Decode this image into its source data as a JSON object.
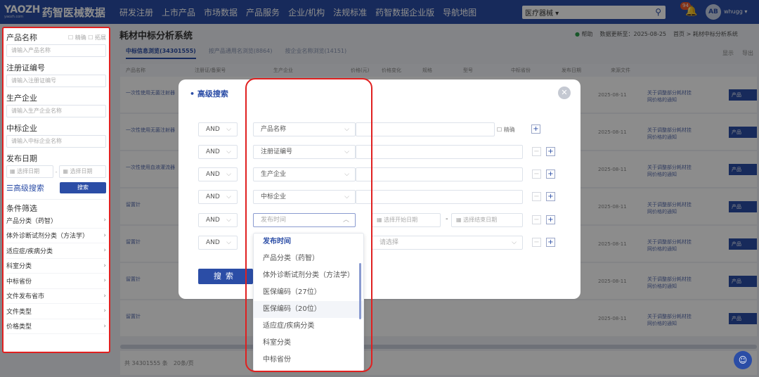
{
  "topbar": {
    "logo_mark": "YAOZH",
    "logo_sub": "yaozh.com",
    "logo_name": "药智医械数据",
    "nav": [
      "研发注册",
      "上市产品",
      "市场数据",
      "产品服务",
      "企业/机构",
      "法规标准",
      "药智数据企业版",
      "导航地图"
    ],
    "search_scope": "医疗器械",
    "badge_count": "94",
    "avatar_text": "AB",
    "username": "whugg"
  },
  "sidebar": {
    "product_name_label": "产品名称",
    "exact_label": "精确",
    "broad_label": "拓展",
    "product_name_placeholder": "请输入产品名称",
    "reg_no_label": "注册证编号",
    "reg_no_placeholder": "请输入注册证编号",
    "manufacturer_label": "生产企业",
    "manufacturer_placeholder": "请输入生产企业名称",
    "bid_company_label": "中标企业",
    "bid_company_placeholder": "请输入中标企业名称",
    "publish_date_label": "发布日期",
    "date_start": "选择日期",
    "date_end": "选择日期",
    "advanced_link": "高级搜索",
    "search_button": "搜索",
    "filter_title": "条件筛选",
    "filters": [
      "产品分类（药智）",
      "体外诊断试剂分类（方法学）",
      "适应症/疾病分类",
      "科室分类",
      "中标省份",
      "文件发布省市",
      "文件类型",
      "价格类型"
    ]
  },
  "main": {
    "title": "耗材中标分析系统",
    "help": "帮助",
    "updated": "数据更新至：2025-08-25",
    "breadcrumb": "首页 > 耗材中标分析系统",
    "tabs": [
      "中标信息浏览(34301555)",
      "按产品通用名浏览(8864)",
      "按企业名称浏览(14151)"
    ],
    "right_actions": [
      "显示",
      "导出"
    ],
    "columns": [
      "产品名称",
      "注册证/备案号",
      "生产企业",
      "价格(元)",
      "价格变化",
      "规格",
      "型号",
      "中标省份",
      "发布日期",
      "来源文件"
    ],
    "rows": [
      {
        "name": "一次性使用无菌注射器",
        "date": "2025-08-11",
        "file": "关于调整部分耗材挂网价格的通知",
        "btn": "产品"
      },
      {
        "name": "一次性使用无菌注射器",
        "date": "2025-08-11",
        "file": "关于调整部分耗材挂网价格的通知",
        "btn": "产品"
      },
      {
        "name": "一次性使用血液灌流器",
        "date": "2025-08-11",
        "file": "关于调整部分耗材挂网价格的通知",
        "btn": "产品"
      },
      {
        "name": "留置针",
        "date": "2025-08-11",
        "file": "关于调整部分耗材挂网价格的通知",
        "btn": "产品"
      },
      {
        "name": "留置针",
        "date": "2025-08-11",
        "file": "关于调整部分耗材挂网价格的通知",
        "btn": "产品"
      },
      {
        "name": "留置针",
        "date": "2025-08-11",
        "file": "关于调整部分耗材挂网价格的通知",
        "btn": "产品"
      },
      {
        "name": "留置针",
        "date": "2025-08-11",
        "file": "关于调整部分耗材挂网价格的通知",
        "btn": "产品"
      }
    ],
    "pager_total": "共 34301555 条",
    "pager_size": "20条/页"
  },
  "modal": {
    "title": "高级搜索",
    "close": "✕",
    "rows": [
      {
        "logic": "AND",
        "field": "产品名称",
        "exact": "精确"
      },
      {
        "logic": "AND",
        "field": "注册证编号"
      },
      {
        "logic": "AND",
        "field": "生产企业"
      },
      {
        "logic": "AND",
        "field": "中标企业"
      },
      {
        "logic": "AND",
        "field": "发布时间",
        "start": "选择开始日期",
        "end": "选择结束日期"
      },
      {
        "logic": "AND",
        "placeholder": "请选择"
      }
    ],
    "search_button": "搜索"
  },
  "dropdown": {
    "items": [
      "发布时间",
      "产品分类（药智）",
      "体外诊断试剂分类（方法学）",
      "医保编码（27位）",
      "医保编码（20位）",
      "适应症/疾病分类",
      "科室分类",
      "中标省份"
    ],
    "selected_index": 0,
    "hover_index": 4
  },
  "colors": {
    "brand": "#2b4da6",
    "highlight_box": "#e02020"
  }
}
